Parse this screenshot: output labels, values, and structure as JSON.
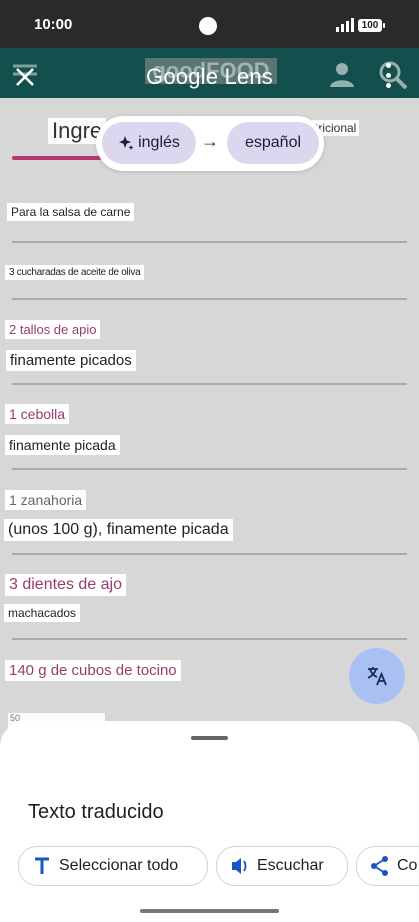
{
  "status_bar": {
    "time": "10:00",
    "battery": "100"
  },
  "app_bar": {
    "title": "Google Lens",
    "background_logo": "goodFOOD"
  },
  "background": {
    "tab_left": "Ingre",
    "tab_right": "tricional"
  },
  "language_selector": {
    "source": "inglés",
    "target": "español",
    "arrow": "→"
  },
  "translations": [
    {
      "id": "t1",
      "text": "Para la salsa de carne"
    },
    {
      "id": "t2",
      "text": "3 cucharadas de aceite de oliva"
    },
    {
      "id": "t3",
      "text": "2 tallos de apio"
    },
    {
      "id": "t4",
      "text": "finamente picados"
    },
    {
      "id": "t5",
      "text": "1 cebolla"
    },
    {
      "id": "t6",
      "text": "finamente picada"
    },
    {
      "id": "t7",
      "text": "1 zanahoria"
    },
    {
      "id": "t8",
      "text": "(unos 100 g), finamente picada"
    },
    {
      "id": "t9",
      "text": "3 dientes de ajo"
    },
    {
      "id": "t10",
      "text": "machacados"
    },
    {
      "id": "t11",
      "text": "140 g de cubos de tocino"
    },
    {
      "id": "t12",
      "text": "50"
    }
  ],
  "bottom_sheet": {
    "title": "Texto traducido",
    "actions": {
      "select_all": "Seleccionar todo",
      "listen": "Escuchar",
      "copy": "Co"
    }
  },
  "icons": {
    "close": "close-icon",
    "menu": "more-vert-icon",
    "translate": "translate-icon",
    "text_select": "text-select-icon",
    "speaker": "speaker-icon",
    "share": "share-icon",
    "sparkle": "sparkle-icon"
  },
  "colors": {
    "accent_chip": "#dcd6ef",
    "fab": "#a8c0f2",
    "app_bar": "#13504d",
    "highlight_text": "#9a3b6e"
  }
}
